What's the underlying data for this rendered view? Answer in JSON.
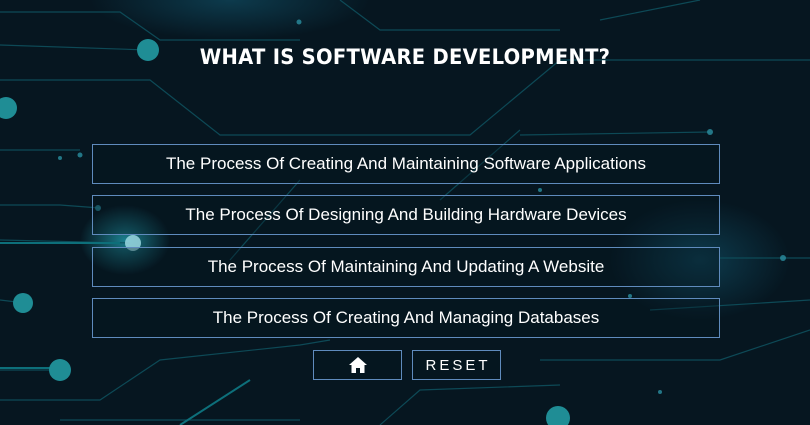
{
  "quiz": {
    "question": "WHAT IS SOFTWARE DEVELOPMENT?",
    "options": [
      {
        "label": "The Process Of Creating And Maintaining Software Applications"
      },
      {
        "label": "The Process Of Designing And Building Hardware Devices"
      },
      {
        "label": "The Process Of Maintaining And Updating A Website"
      },
      {
        "label": "The Process Of Creating And Managing Databases"
      }
    ]
  },
  "controls": {
    "home_icon": "home-icon",
    "reset_label": "RESET"
  },
  "colors": {
    "background": "#061620",
    "circuit": "#0e5d6a",
    "node": "#1f8d95",
    "border": "#5f8bbd",
    "text": "#ffffff"
  }
}
